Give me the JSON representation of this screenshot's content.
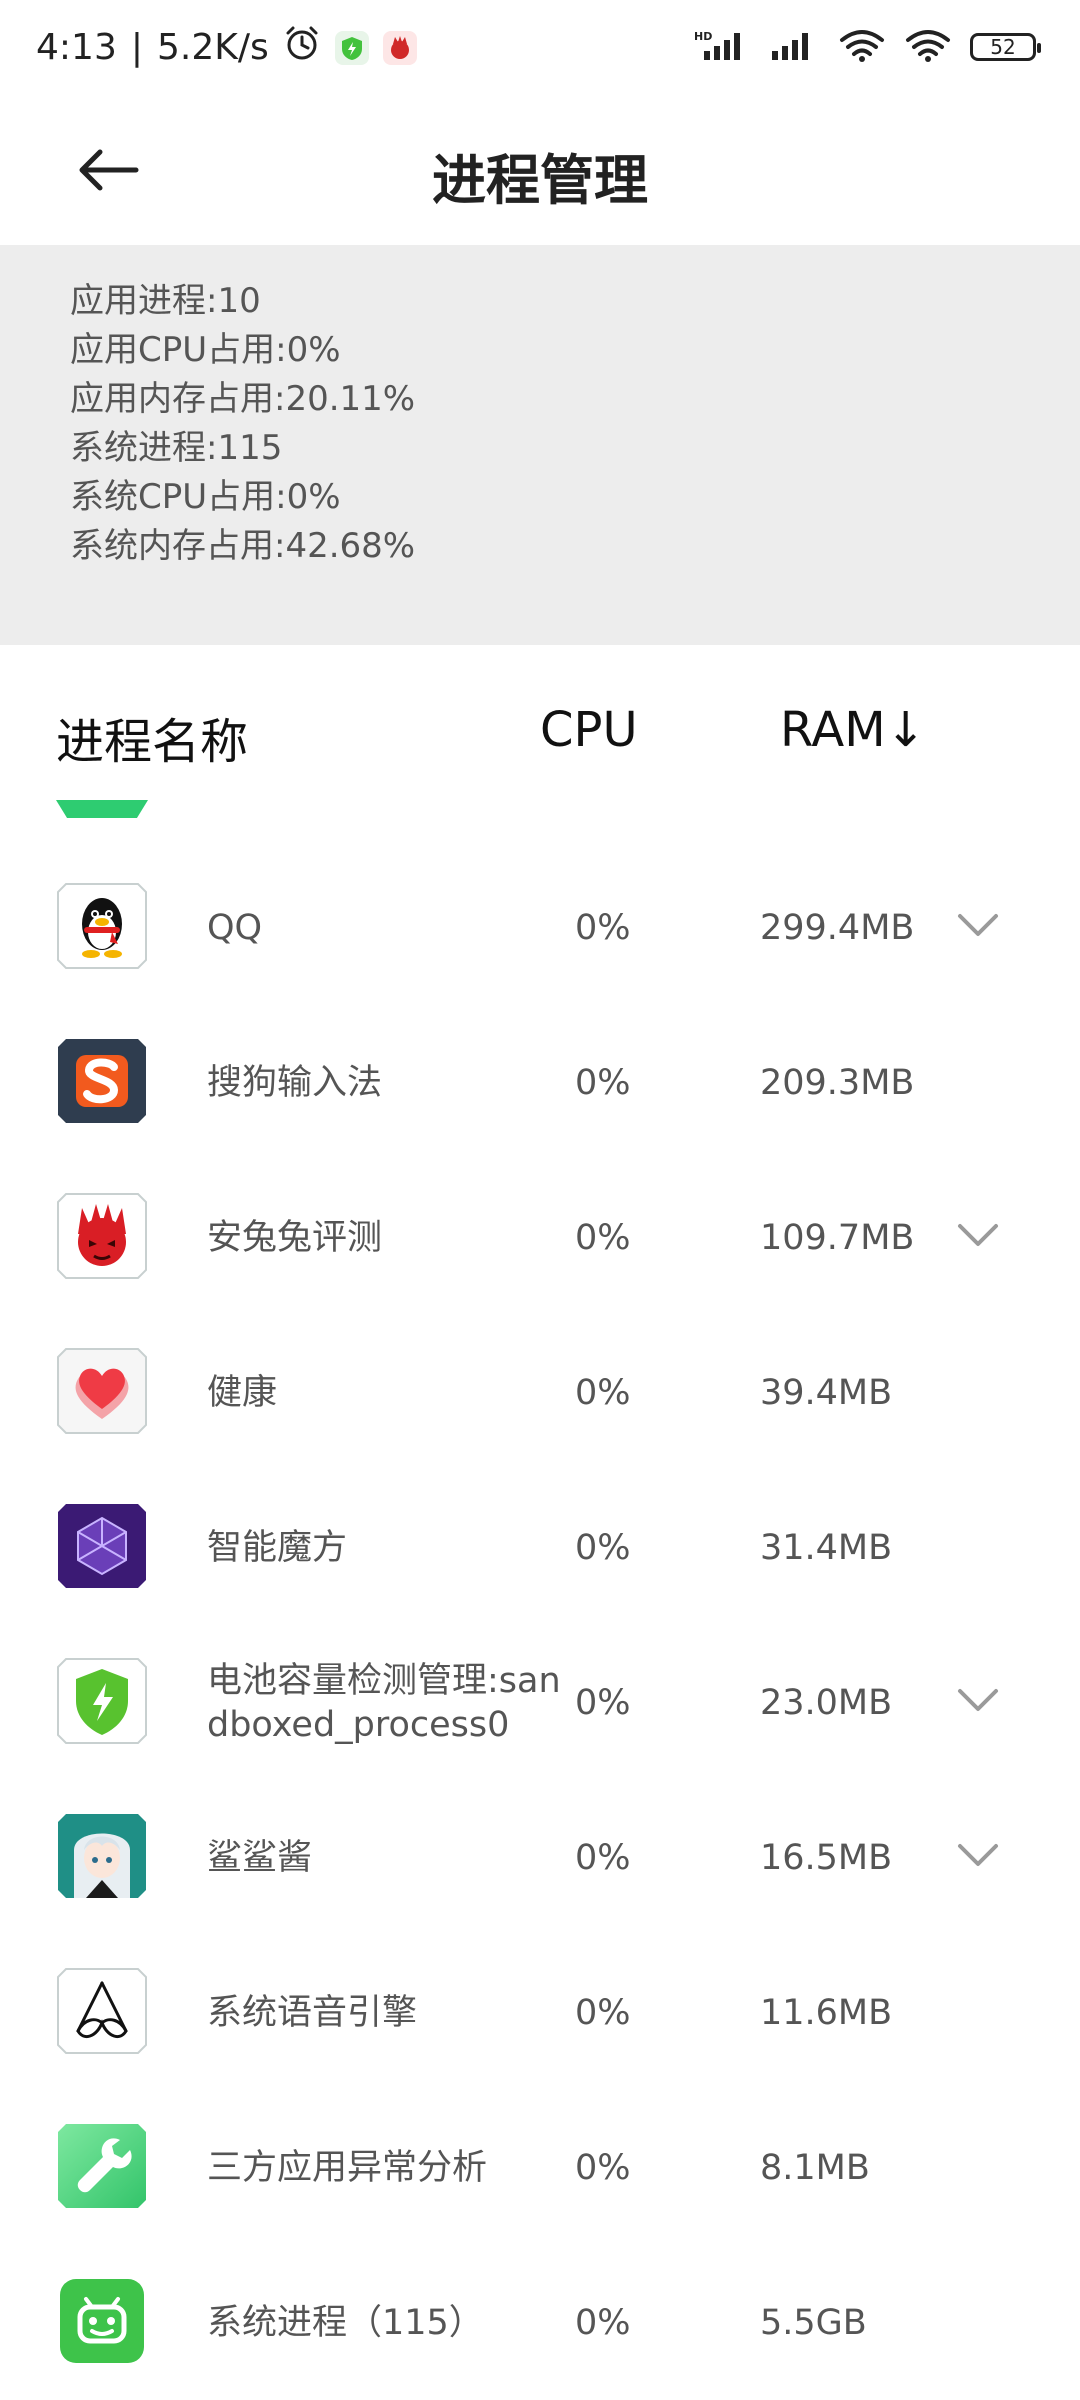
{
  "status_bar": {
    "time": "4:13",
    "separator": "|",
    "speed": "5.2K/s",
    "hd_label": "HD",
    "battery": "52",
    "icons": [
      "alarm-icon",
      "battery-app-icon",
      "antutu-app-icon",
      "signal-icon",
      "signal-icon",
      "wifi-icon",
      "wifi-icon",
      "battery-icon"
    ]
  },
  "header": {
    "title": "进程管理",
    "back_icon": "arrow-left-icon"
  },
  "summary": {
    "lines": [
      "应用进程:10",
      "应用CPU占用:0%",
      "应用内存占用:20.11%",
      "系统进程:115",
      "系统CPU占用:0%",
      "系统内存占用:42.68%"
    ]
  },
  "table": {
    "headers": {
      "name": "进程名称",
      "cpu": "CPU",
      "ram": "RAM↓"
    },
    "rows": [
      {
        "name": "QQ",
        "cpu": "0%",
        "ram": "299.4MB",
        "icon": "qq-icon",
        "expandable": true
      },
      {
        "name": "搜狗输入法",
        "cpu": "0%",
        "ram": "209.3MB",
        "icon": "sogou-icon",
        "expandable": false
      },
      {
        "name": "安兔兔评测",
        "cpu": "0%",
        "ram": "109.7MB",
        "icon": "antutu-icon",
        "expandable": true
      },
      {
        "name": "健康",
        "cpu": "0%",
        "ram": "39.4MB",
        "icon": "heart-icon",
        "expandable": false
      },
      {
        "name": "智能魔方",
        "cpu": "0%",
        "ram": "31.4MB",
        "icon": "cube-icon",
        "expandable": false
      },
      {
        "name": "电池容量检测管理:sandboxed_process0",
        "cpu": "0%",
        "ram": "23.0MB",
        "icon": "shield-bolt-icon",
        "expandable": true
      },
      {
        "name": "鲨鲨酱",
        "cpu": "0%",
        "ram": "16.5MB",
        "icon": "anime-girl-icon",
        "expandable": true
      },
      {
        "name": "系统语音引擎",
        "cpu": "0%",
        "ram": "11.6MB",
        "icon": "voice-engine-icon",
        "expandable": false
      },
      {
        "name": "三方应用异常分析",
        "cpu": "0%",
        "ram": "8.1MB",
        "icon": "wrench-icon",
        "expandable": false
      },
      {
        "name": "系统进程（115）",
        "cpu": "0%",
        "ram": "5.5GB",
        "icon": "android-robot-icon",
        "expandable": false
      }
    ]
  },
  "colors": {
    "summary_bg": "#ededed",
    "accent_green": "#2ecc71"
  }
}
